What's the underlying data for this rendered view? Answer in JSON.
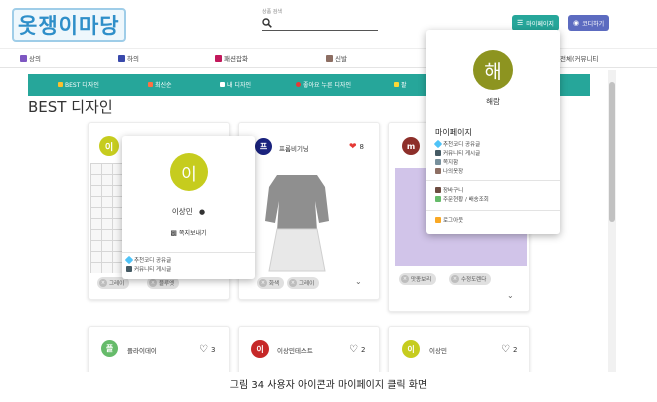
{
  "header": {
    "logo_text": "옷쟁이마당",
    "search_label": "상품 검색",
    "search_placeholder": "",
    "mypage_button": "마이페이지",
    "coordi_button": "코디하기"
  },
  "categories": [
    {
      "label": "상의",
      "color": "#7e57c2"
    },
    {
      "label": "하의",
      "color": "#3949ab"
    },
    {
      "label": "패션잡화",
      "color": "#c2185b"
    },
    {
      "label": "신발",
      "color": "#8d6e63"
    },
    {
      "label": "전체(커뮤니티",
      "color": "#757575"
    }
  ],
  "tabs": [
    {
      "label": "BEST 디자인",
      "color": "#fbc02d"
    },
    {
      "label": "최신순",
      "color": "#ff7043"
    },
    {
      "label": "내 디자인",
      "color": "#ffffff"
    },
    {
      "label": "좋아요 누른 디자인",
      "color": "#e53935"
    },
    {
      "label": "팔",
      "color": "#fdd835"
    }
  ],
  "section_title": "BEST 디자인",
  "cards": [
    {
      "initial": "이",
      "avatar_color": "#c6cc1e",
      "name": "",
      "likes": "",
      "chips": [
        "그레이",
        "블루엣"
      ]
    },
    {
      "initial": "프",
      "avatar_color": "#1a237e",
      "name": "프롬비기닝",
      "likes": "8",
      "chips": [
        "화색",
        "그레이"
      ]
    },
    {
      "initial": "m",
      "avatar_color": "#8d2f2a",
      "name": "",
      "likes": "",
      "chips": [
        "맛종보리",
        "수정도렌다"
      ]
    },
    {
      "initial": "플",
      "avatar_color": "#66bb6a",
      "name": "플라이데이",
      "likes": "3",
      "chips": []
    },
    {
      "initial": "이",
      "avatar_color": "#c62828",
      "name": "이상민테스트",
      "likes": "2",
      "chips": []
    },
    {
      "initial": "이",
      "avatar_color": "#c6cc1e",
      "name": "이상민",
      "likes": "2",
      "chips": []
    }
  ],
  "user_popup": {
    "initial": "이",
    "avatar_color": "#c6cc1e",
    "name": "이상민",
    "message_button": "쪽지보내기",
    "links": [
      "추천코디 공유글",
      "커뮤니티 게시글"
    ]
  },
  "mypage_dropdown": {
    "initial": "해",
    "avatar_color": "#8d9420",
    "name": "해람",
    "title": "마이페이지",
    "group1": [
      "추천코디 공유글",
      "커뮤니티 게시글",
      "쪽지함",
      "나의옷장"
    ],
    "group2": [
      "장바구니",
      "주문현황 / 배송조회"
    ],
    "logout": "로그아웃"
  },
  "caption": "그림 34 사용자 아이콘과 마이페이지 클릭 화면"
}
